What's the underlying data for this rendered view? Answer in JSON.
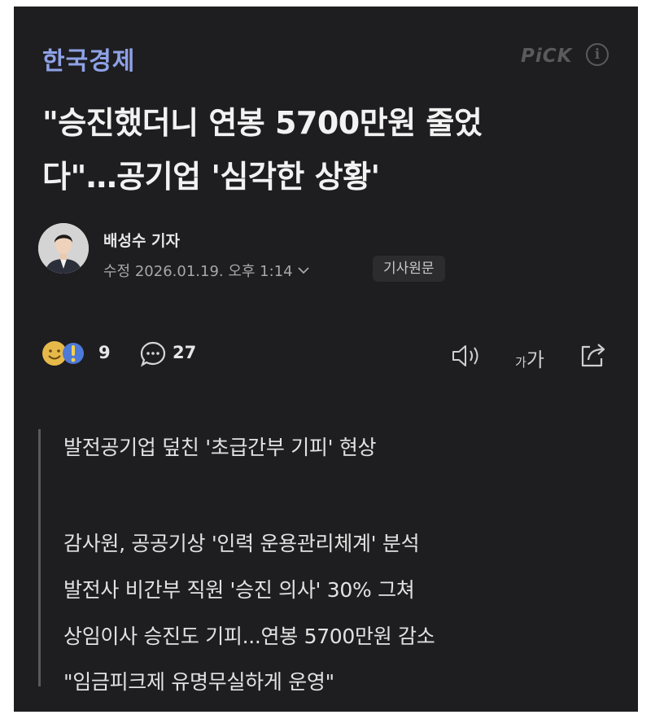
{
  "header": {
    "press": "한국경제",
    "pick": "PiCK",
    "info_icon": "i"
  },
  "article": {
    "title_line1": "\"승진했더니 연봉 5700만원 줄었",
    "title_line2": "다\"…공기업 '심각한 상황'",
    "reporter": "배성수 기자",
    "timestamp": "수정 2026.01.19. 오후 1:14",
    "original_button": "기사원문"
  },
  "toolbar": {
    "reaction_count": "9",
    "comment_count": "27",
    "font_small": "가",
    "font_large": "가",
    "icons": [
      "reaction-emoji-icon",
      "comment-icon",
      "speaker-icon",
      "font-size-icon",
      "share-icon"
    ]
  },
  "summary": {
    "lines": [
      "발전공기업 덮친 '초급간부 기피' 현상",
      "감사원, 공공기상 '인력 운용관리체계' 분석",
      "발전사 비간부 직원 '승진 의사' 30% 그쳐",
      "상임이사 승진도 기피...연봉 5700만원 감소",
      "\"임금피크제 유명무실하게 운영\""
    ]
  },
  "colors": {
    "background": "#1e1e20",
    "press": "#8fa2e8",
    "text": "#f2f2f2",
    "muted": "#a7a7ab"
  }
}
